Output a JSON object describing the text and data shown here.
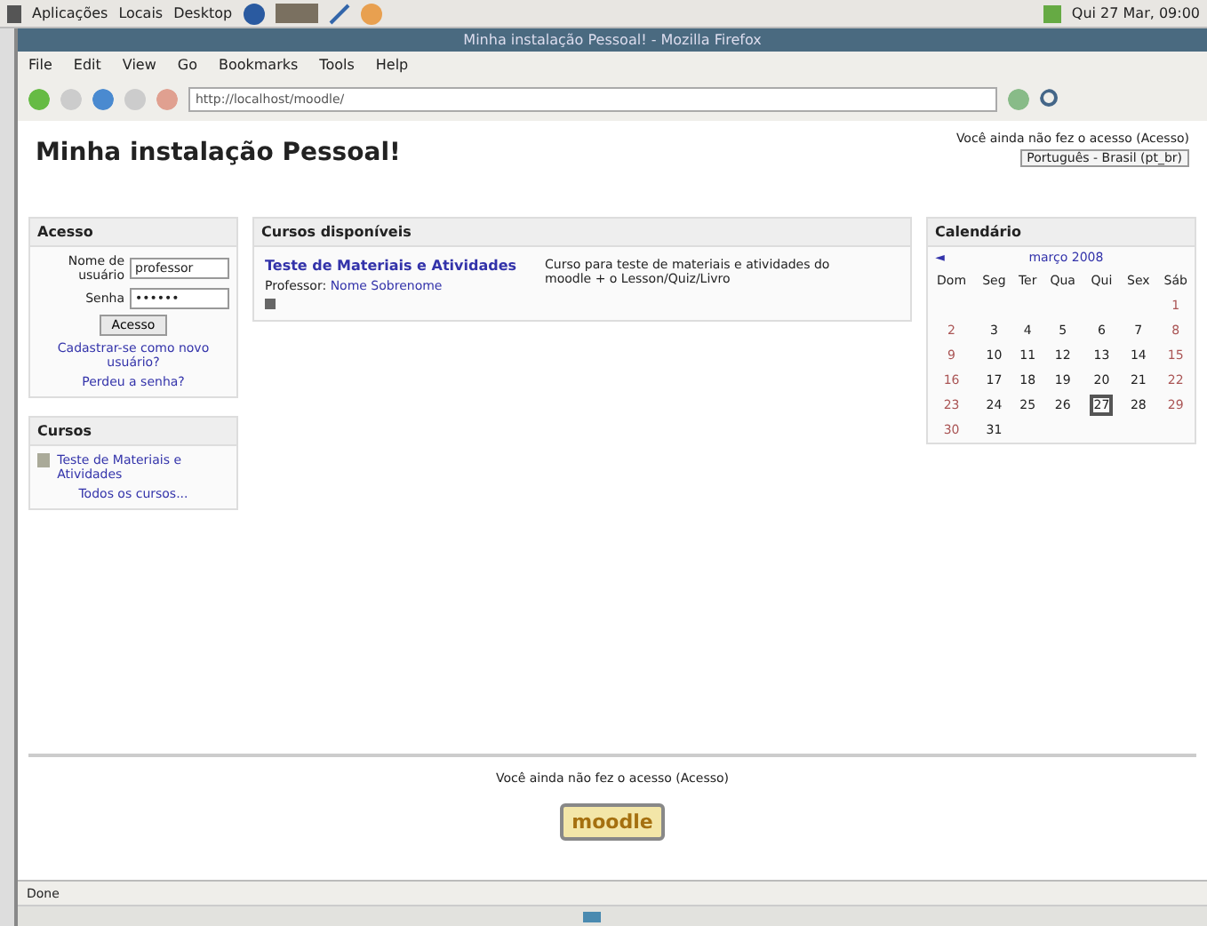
{
  "desktop_panel": {
    "menus": [
      "Aplicações",
      "Locais",
      "Desktop"
    ],
    "clock": "Qui 27 Mar, 09:00"
  },
  "window": {
    "title": "Minha instalação Pessoal! - Mozilla Firefox"
  },
  "menu_bar": [
    "File",
    "Edit",
    "View",
    "Go",
    "Bookmarks",
    "Tools",
    "Help"
  ],
  "toolbar": {
    "address": "http://localhost/moodle/"
  },
  "page": {
    "site_name": "Minha instalação Pessoal!",
    "login_info": "Você ainda não fez o acesso (Acesso)",
    "language": "Português - Brasil (pt_br)",
    "login_block": {
      "title": "Acesso",
      "username_label": "Nome de usuário",
      "username": "professor",
      "password_label": "Senha",
      "password": "••••••",
      "button": "Acesso",
      "links": [
        "Cadastrar-se como novo usuário?",
        "Perdeu a senha?"
      ]
    },
    "courses_block": {
      "title": "Cursos",
      "items": [
        "Teste de Materiais e Atividades"
      ],
      "all_link": "Todos os cursos..."
    },
    "available_courses": {
      "title": "Cursos disponíveis",
      "courses": [
        {
          "name": "Teste de Materiais e Atividades",
          "teacher_label": "Professor:",
          "teacher": "Nome Sobrenome",
          "description": "Curso para teste de materiais e atividades do moodle + o Lesson/Quiz/Livro"
        }
      ]
    },
    "calendar": {
      "title": "Calendário",
      "prev": "◄",
      "month": "março 2008",
      "weekdays": [
        "Dom",
        "Seg",
        "Ter",
        "Qua",
        "Qui",
        "Sex",
        "Sáb"
      ],
      "weeks": [
        [
          {
            "day": "1",
            "selected": false
          }
        ],
        [
          {
            "day": "2",
            "selected": false
          },
          {
            "day": "3",
            "selected": false
          },
          {
            "day": "4",
            "selected": false
          },
          {
            "day": "5",
            "selected": false
          },
          {
            "day": "6",
            "selected": false
          },
          {
            "day": "7",
            "selected": false
          },
          {
            "day": "8",
            "selected": false
          }
        ],
        [
          {
            "day": "9",
            "selected": false
          },
          {
            "day": "10",
            "selected": false
          },
          {
            "day": "11",
            "selected": false
          },
          {
            "day": "12",
            "selected": false
          },
          {
            "day": "13",
            "selected": false
          },
          {
            "day": "14",
            "selected": false
          },
          {
            "day": "15",
            "selected": false
          }
        ],
        [
          {
            "day": "16",
            "selected": false
          },
          {
            "day": "17",
            "selected": false
          },
          {
            "day": "18",
            "selected": false
          },
          {
            "day": "19",
            "selected": false
          },
          {
            "day": "20",
            "selected": false
          },
          {
            "day": "21",
            "selected": false
          },
          {
            "day": "22",
            "selected": false
          }
        ],
        [
          {
            "day": "23",
            "selected": false
          },
          {
            "day": "24",
            "selected": false
          },
          {
            "day": "25",
            "selected": false
          },
          {
            "day": "26",
            "selected": false
          },
          {
            "day": "27",
            "selected": true
          },
          {
            "day": "28",
            "selected": false
          },
          {
            "day": "29",
            "selected": false
          }
        ],
        [
          {
            "day": "30",
            "selected": false
          },
          {
            "day": "31",
            "selected": false
          }
        ]
      ]
    },
    "footer": {
      "login_info": "Você ainda não fez o acesso (Acesso)",
      "logo": "moodle"
    }
  },
  "status_bar": {
    "text": "Done"
  }
}
